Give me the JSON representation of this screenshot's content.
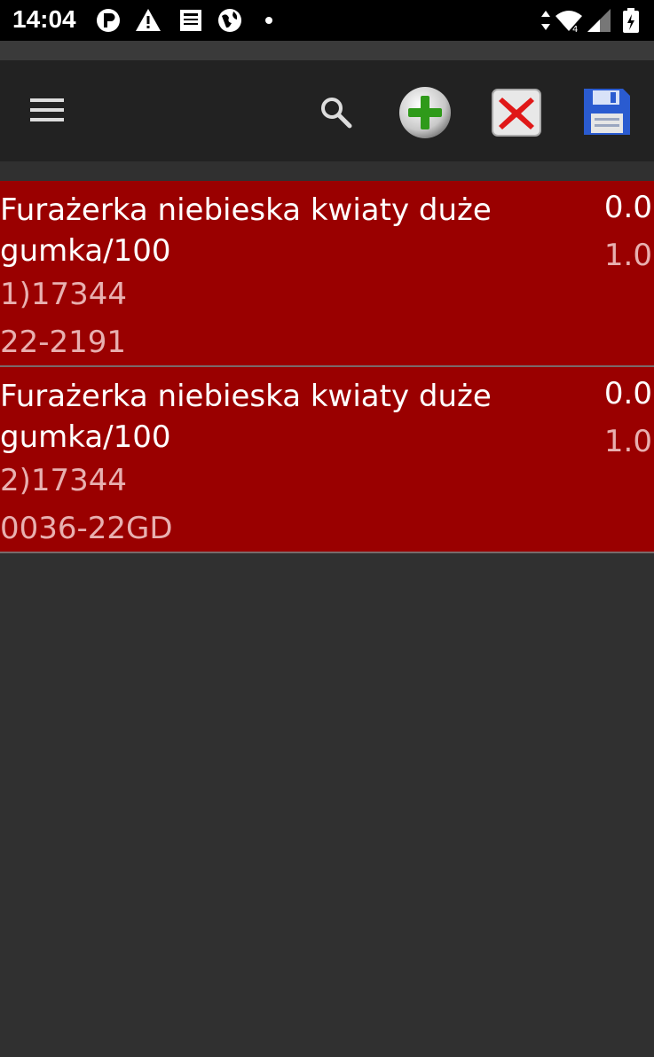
{
  "status_bar": {
    "time": "14:04",
    "icons": [
      "app-p-icon",
      "warning-icon",
      "news-icon",
      "globe-icon",
      "dot-icon",
      "data-arrows-icon",
      "wifi-icon",
      "signal-icon",
      "battery-icon"
    ]
  },
  "toolbar": {
    "icons": [
      "menu-icon",
      "search-icon",
      "add-icon",
      "delete-icon",
      "save-icon"
    ]
  },
  "colors": {
    "background": "#303030",
    "toolbar": "#222222",
    "row_background": "#9a0000",
    "secondary_text": "#e8b0b0"
  },
  "items": [
    {
      "title": "Furażerka niebieska kwiaty duże gumka/100",
      "code": "1)17344",
      "sub": "22-2191",
      "value1": "0.0",
      "value2": "1.0"
    },
    {
      "title": "Furażerka niebieska kwiaty duże gumka/100",
      "code": "2)17344",
      "sub": "0036-22GD",
      "value1": "0.0",
      "value2": "1.0"
    }
  ]
}
